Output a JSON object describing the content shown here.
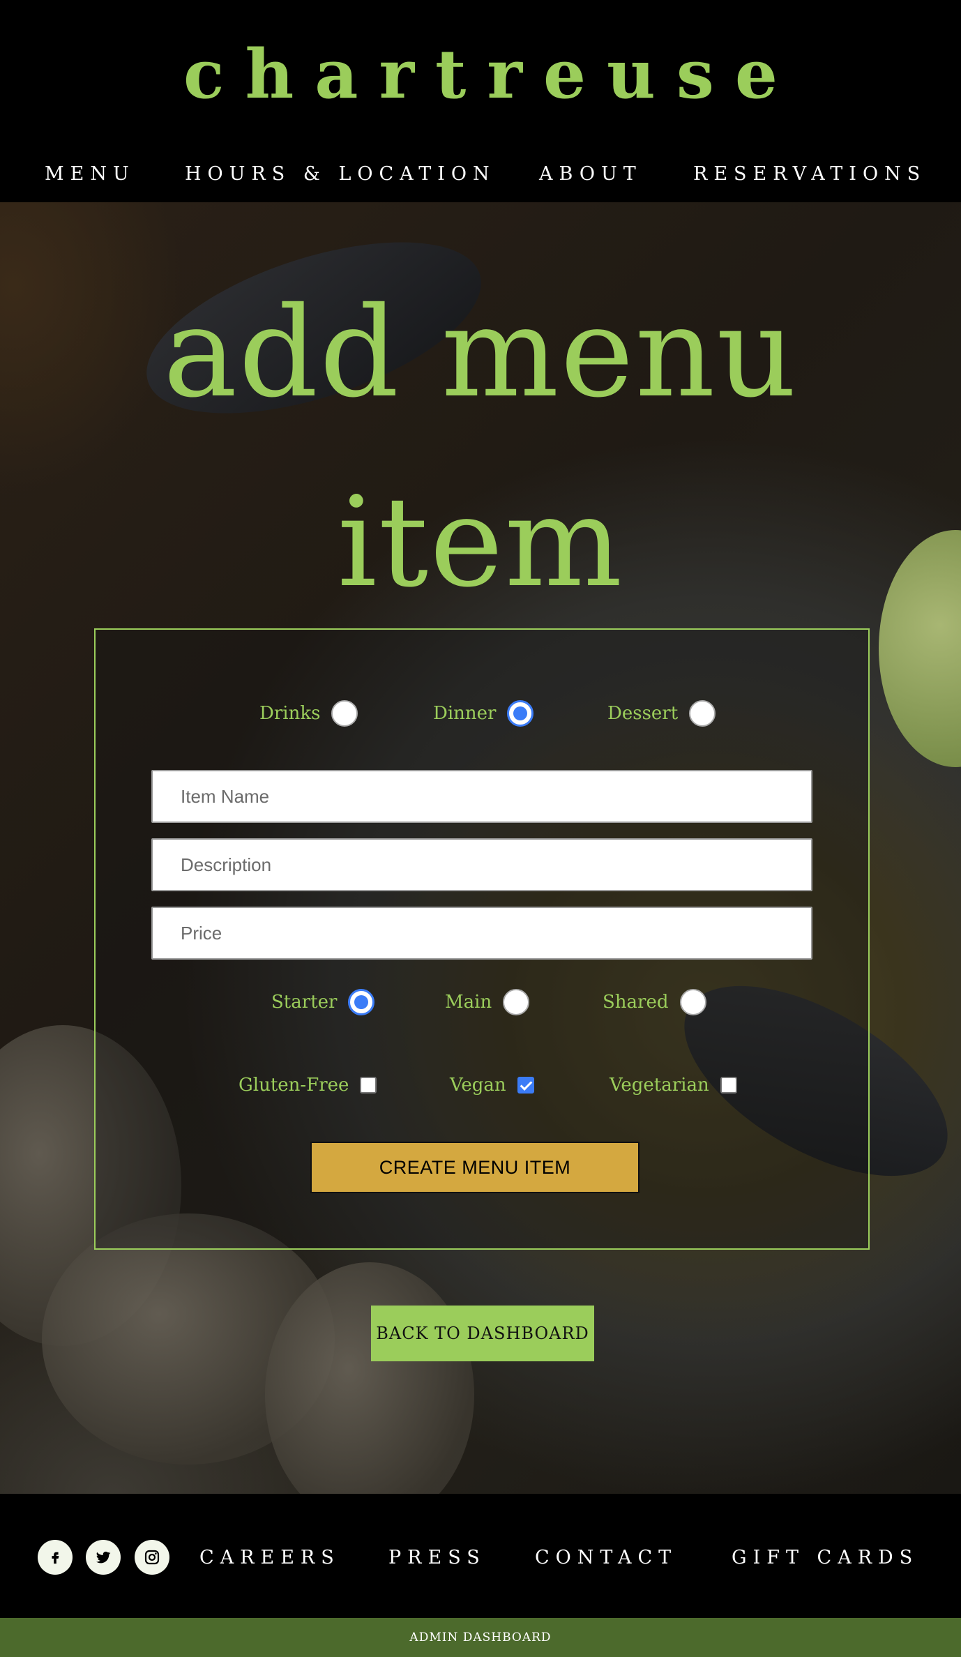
{
  "brand": {
    "name": "chartreuse"
  },
  "nav": {
    "items": [
      "MENU",
      "HOURS & LOCATION",
      "ABOUT",
      "RESERVATIONS"
    ]
  },
  "page": {
    "title": "add menu item"
  },
  "form": {
    "category": {
      "options": [
        "Drinks",
        "Dinner",
        "Dessert"
      ],
      "selected": "Dinner"
    },
    "fields": {
      "item_name_placeholder": "Item Name",
      "description_placeholder": "Description",
      "price_placeholder": "Price"
    },
    "course": {
      "options": [
        "Starter",
        "Main",
        "Shared"
      ],
      "selected": "Starter"
    },
    "diet": {
      "options": [
        {
          "label": "Gluten-Free",
          "checked": false
        },
        {
          "label": "Vegan",
          "checked": true
        },
        {
          "label": "Vegetarian",
          "checked": false
        }
      ]
    },
    "submit_label": "CREATE MENU ITEM"
  },
  "back_button": {
    "label": "BACK TO DASHBOARD"
  },
  "footer": {
    "social": [
      "facebook-icon",
      "twitter-icon",
      "instagram-icon"
    ],
    "links": [
      "CAREERS",
      "PRESS",
      "CONTACT",
      "GIFT CARDS"
    ]
  },
  "admin_bar": {
    "label": "ADMIN DASHBOARD"
  },
  "colors": {
    "accent": "#9bcd5b",
    "button": "#d4a840",
    "admin_bar": "#4c6a2c",
    "radio_selected": "#3b7cf7"
  }
}
